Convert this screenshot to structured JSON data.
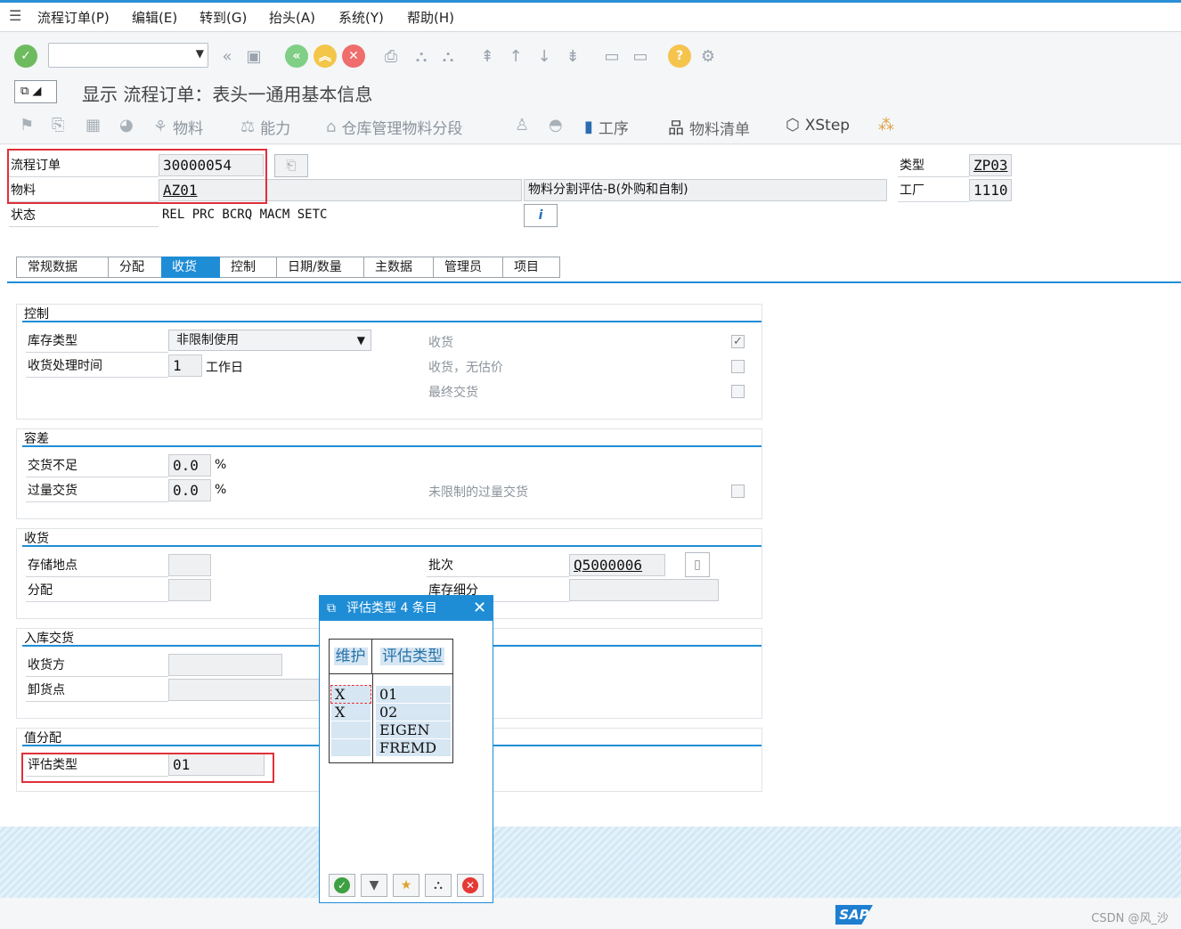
{
  "menubar": {
    "items": [
      "流程订单(P)",
      "编辑(E)",
      "转到(G)",
      "抬头(A)",
      "系统(Y)",
      "帮助(H)"
    ]
  },
  "header": {
    "title": "显示 流程订单：表头一通用基本信息"
  },
  "appbar": {
    "material": "物料",
    "capacity": "能力",
    "warehouse": "仓库管理物料分段",
    "operation": "工序",
    "bom": "物料清单",
    "xstep": "XStep"
  },
  "order": {
    "order_label": "流程订单",
    "order_value": "30000054",
    "material_label": "物料",
    "material_value": "AZ01",
    "material_desc": "物料分割评估-B(外购和自制)",
    "status_label": "状态",
    "status_value": "REL  PRC  BCRQ MACM SETC",
    "type_label": "类型",
    "type_value": "ZP03",
    "plant_label": "工厂",
    "plant_value": "1110"
  },
  "tabs": [
    "常规数据",
    "分配",
    "收货",
    "控制",
    "日期/数量",
    "主数据",
    "管理员",
    "项目"
  ],
  "control": {
    "title": "控制",
    "stock_type_label": "库存类型",
    "stock_type_value": "非限制使用",
    "gr_time_label": "收货处理时间",
    "gr_time_value": "1",
    "gr_time_unit": "工作日",
    "gr_label": "收货",
    "gr_nonval_label": "收货，无估价",
    "final_delivery_label": "最终交货"
  },
  "tolerance": {
    "title": "容差",
    "under_label": "交货不足",
    "under_value": "0.0",
    "over_label": "过量交货",
    "over_value": "0.0",
    "percent": "%",
    "unlimited_label": "未限制的过量交货"
  },
  "receipt": {
    "title": "收货",
    "sloc_label": "存储地点",
    "assign_label": "分配",
    "batch_label": "批次",
    "batch_value": "Q5000006",
    "stock_segment_label": "库存细分"
  },
  "delivery": {
    "title": "入库交货",
    "recipient_label": "收货方",
    "unloading_label": "卸货点"
  },
  "valuation": {
    "title": "值分配",
    "val_type_label": "评估类型",
    "val_type_value": "01"
  },
  "popup": {
    "title": "评估类型 4 条目",
    "col_maintain": "维护",
    "col_valtype": "评估类型",
    "rows": [
      {
        "maintain": "X",
        "valtype": "01"
      },
      {
        "maintain": "X",
        "valtype": "02"
      },
      {
        "maintain": "",
        "valtype": "EIGEN"
      },
      {
        "maintain": "",
        "valtype": "FREMD"
      }
    ]
  },
  "status": {
    "logo": "SAP",
    "watermark": "CSDN @风_沙"
  },
  "colors": {
    "accent": "#1f8dd6",
    "highlight_red": "#e0303a",
    "ok_green": "#4caf50",
    "cancel_red": "#e53935"
  }
}
